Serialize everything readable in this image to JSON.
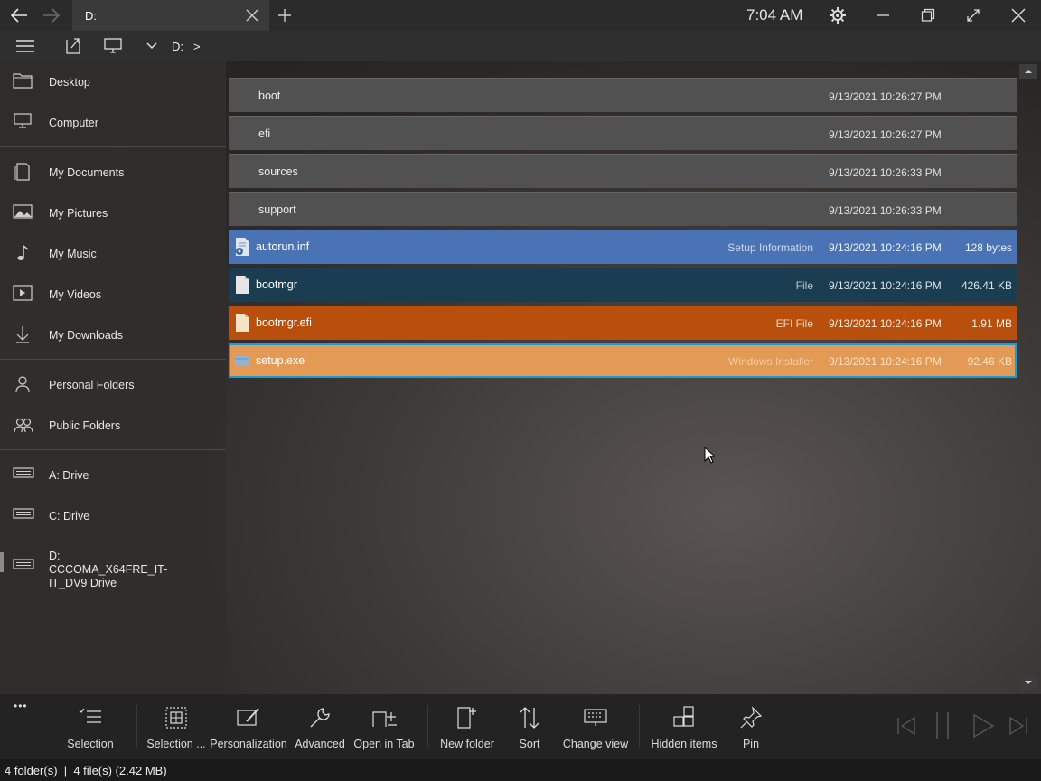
{
  "titlebar": {
    "tab_title": "D:",
    "clock": "7:04 AM",
    "icons": [
      "back-arrow-icon",
      "forward-arrow-icon",
      "close-tab-icon",
      "new-tab-icon",
      "gear-icon",
      "minimize-icon",
      "restore-icon",
      "fullscreen-icon",
      "close-icon"
    ]
  },
  "addressbar": {
    "drive": "D:",
    "separator": ">"
  },
  "sidebar": {
    "items": [
      {
        "label": "Desktop",
        "icon": "folder-icon"
      },
      {
        "label": "Computer",
        "icon": "monitor-icon"
      },
      {
        "label": "My Documents",
        "icon": "document-icon"
      },
      {
        "label": "My Pictures",
        "icon": "picture-icon"
      },
      {
        "label": "My Music",
        "icon": "music-icon"
      },
      {
        "label": "My Videos",
        "icon": "video-icon"
      },
      {
        "label": "My Downloads",
        "icon": "download-icon"
      },
      {
        "label": "Personal Folders",
        "icon": "person-icon"
      },
      {
        "label": "Public Folders",
        "icon": "people-icon"
      },
      {
        "label": "A:  Drive",
        "icon": "drive-icon"
      },
      {
        "label": "C:  Drive",
        "icon": "drive-icon"
      },
      {
        "label": "D: CCCOMA_X64FRE_IT-IT_DV9 Drive",
        "icon": "drive-icon"
      }
    ]
  },
  "files": {
    "folders": [
      {
        "name": "boot",
        "date": "9/13/2021 10:26:27 PM"
      },
      {
        "name": "efi",
        "date": "9/13/2021 10:26:27 PM"
      },
      {
        "name": "sources",
        "date": "9/13/2021 10:26:33 PM"
      },
      {
        "name": "support",
        "date": "9/13/2021 10:26:33 PM"
      }
    ],
    "items": [
      {
        "name": "autorun.inf",
        "type": "Setup Information",
        "date": "9/13/2021 10:24:16 PM",
        "size": "128 bytes",
        "color": "#4a73b5"
      },
      {
        "name": "bootmgr",
        "type": "File",
        "date": "9/13/2021 10:24:16 PM",
        "size": "426.41 KB",
        "color": "#1b3d52"
      },
      {
        "name": "bootmgr.efi",
        "type": "EFI File",
        "date": "9/13/2021 10:24:16 PM",
        "size": "1.91 MB",
        "color": "#b84f0c"
      },
      {
        "name": "setup.exe",
        "type": "Windows Installer",
        "date": "9/13/2021 10:24:16 PM",
        "size": "92.46 KB",
        "color": "#e39a55"
      }
    ]
  },
  "toolbar": {
    "more": "•••",
    "buttons": [
      {
        "label": "Selection",
        "icon": "selection-list-icon"
      },
      {
        "label": "Selection ...",
        "icon": "selection-grid-icon"
      },
      {
        "label": "Personalization",
        "icon": "personalization-icon"
      },
      {
        "label": "Advanced",
        "icon": "wrench-icon"
      },
      {
        "label": "Open in Tab",
        "icon": "open-in-tab-icon"
      },
      {
        "label": "New folder",
        "icon": "new-folder-icon"
      },
      {
        "label": "Sort",
        "icon": "sort-icon"
      },
      {
        "label": "Change view",
        "icon": "change-view-icon"
      },
      {
        "label": "Hidden items",
        "icon": "hidden-items-icon"
      },
      {
        "label": "Pin",
        "icon": "pin-icon"
      }
    ],
    "media_icons": [
      "skip-back-icon",
      "pause-icon",
      "play-icon",
      "skip-forward-icon"
    ]
  },
  "status": {
    "text": "4 folder(s)  |  4 file(s) (2.42 MB)"
  }
}
